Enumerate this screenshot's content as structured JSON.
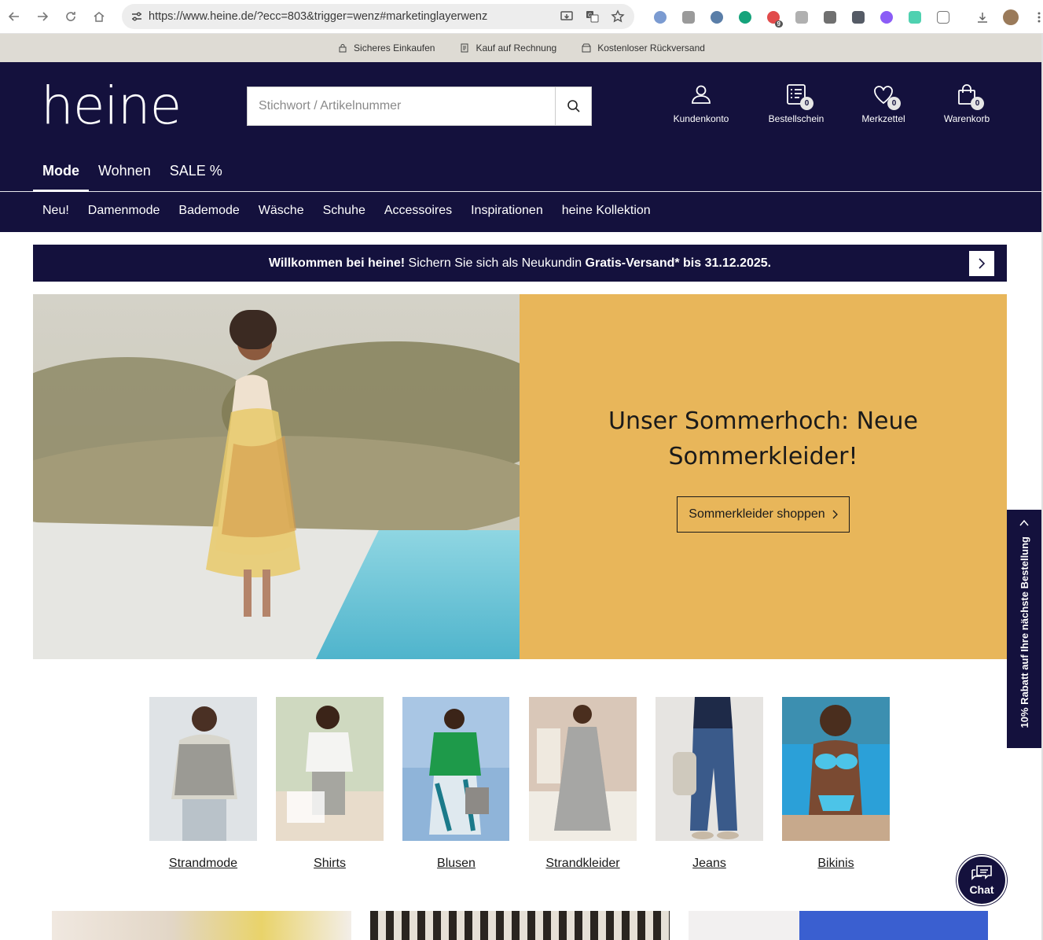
{
  "browser": {
    "url": "https://www.heine.de/?ecc=803&trigger=wenz#marketinglayerwenz",
    "extensions": [
      {
        "icon": "shield-ext-icon",
        "color": "#7b9bd1"
      },
      {
        "icon": "camera-ext-icon",
        "color": "#9a9a9a"
      },
      {
        "icon": "gear-ext-icon",
        "color": "#5a7ea8"
      },
      {
        "icon": "grammarly-ext-icon",
        "color": "#15a37b"
      },
      {
        "icon": "red-badge-ext-icon",
        "color": "#e14b4b"
      },
      {
        "icon": "slash-ext-icon",
        "color": "#b0b0b0"
      },
      {
        "icon": "g-ext-icon",
        "color": "#707070"
      },
      {
        "icon": "dots-ext-icon",
        "color": "#555b66"
      },
      {
        "icon": "purple-ext-icon",
        "color": "#8b5cf6"
      },
      {
        "icon": "green-ext-icon",
        "color": "#4fd1b0"
      },
      {
        "icon": "puzzle-ext-icon",
        "color": "#777777"
      }
    ],
    "ext_badge": "9"
  },
  "trust": [
    {
      "icon": "lock-icon",
      "label": "Sicheres Einkaufen"
    },
    {
      "icon": "receipt-icon",
      "label": "Kauf auf Rechnung"
    },
    {
      "icon": "package-icon",
      "label": "Kostenloser Rückversand"
    }
  ],
  "header": {
    "logo": "heine",
    "search_placeholder": "Stichwort / Artikelnummer",
    "icons": [
      {
        "label": "Kundenkonto",
        "icon": "user-icon",
        "badge": ""
      },
      {
        "label": "Bestellschein",
        "icon": "order-list-icon",
        "badge": "0"
      },
      {
        "label": "Merkzettel",
        "icon": "heart-icon",
        "badge": "0"
      },
      {
        "label": "Warenkorb",
        "icon": "shopping-bag-icon",
        "badge": "0"
      }
    ],
    "topnav": [
      {
        "label": "Mode",
        "active": true
      },
      {
        "label": "Wohnen",
        "active": false
      },
      {
        "label": "SALE %",
        "active": false
      }
    ],
    "catnav": [
      "Neu!",
      "Damenmode",
      "Bademode",
      "Wäsche",
      "Schuhe",
      "Accessoires",
      "Inspirationen",
      "heine Kollektion"
    ]
  },
  "promo": {
    "bold1": "Willkommen bei heine!",
    "text": " Sichern Sie sich als Neukundin ",
    "bold2": "Gratis-Versand* bis 31.12.2025."
  },
  "hero": {
    "title": "Unser Sommerhoch: Neue Sommerkleider!",
    "button": "Sommerkleider shoppen",
    "panel_color": "#e8b65a"
  },
  "sidetab": {
    "text": "10% Rabatt auf Ihre nächste Bestellung"
  },
  "categories": [
    {
      "label": "Strandmode"
    },
    {
      "label": "Shirts"
    },
    {
      "label": "Blusen"
    },
    {
      "label": "Strandkleider"
    },
    {
      "label": "Jeans"
    },
    {
      "label": "Bikinis"
    }
  ],
  "chat": {
    "label": "Chat"
  },
  "colors": {
    "brand_navy": "#14113d",
    "trust_bg": "#dedbd4"
  }
}
